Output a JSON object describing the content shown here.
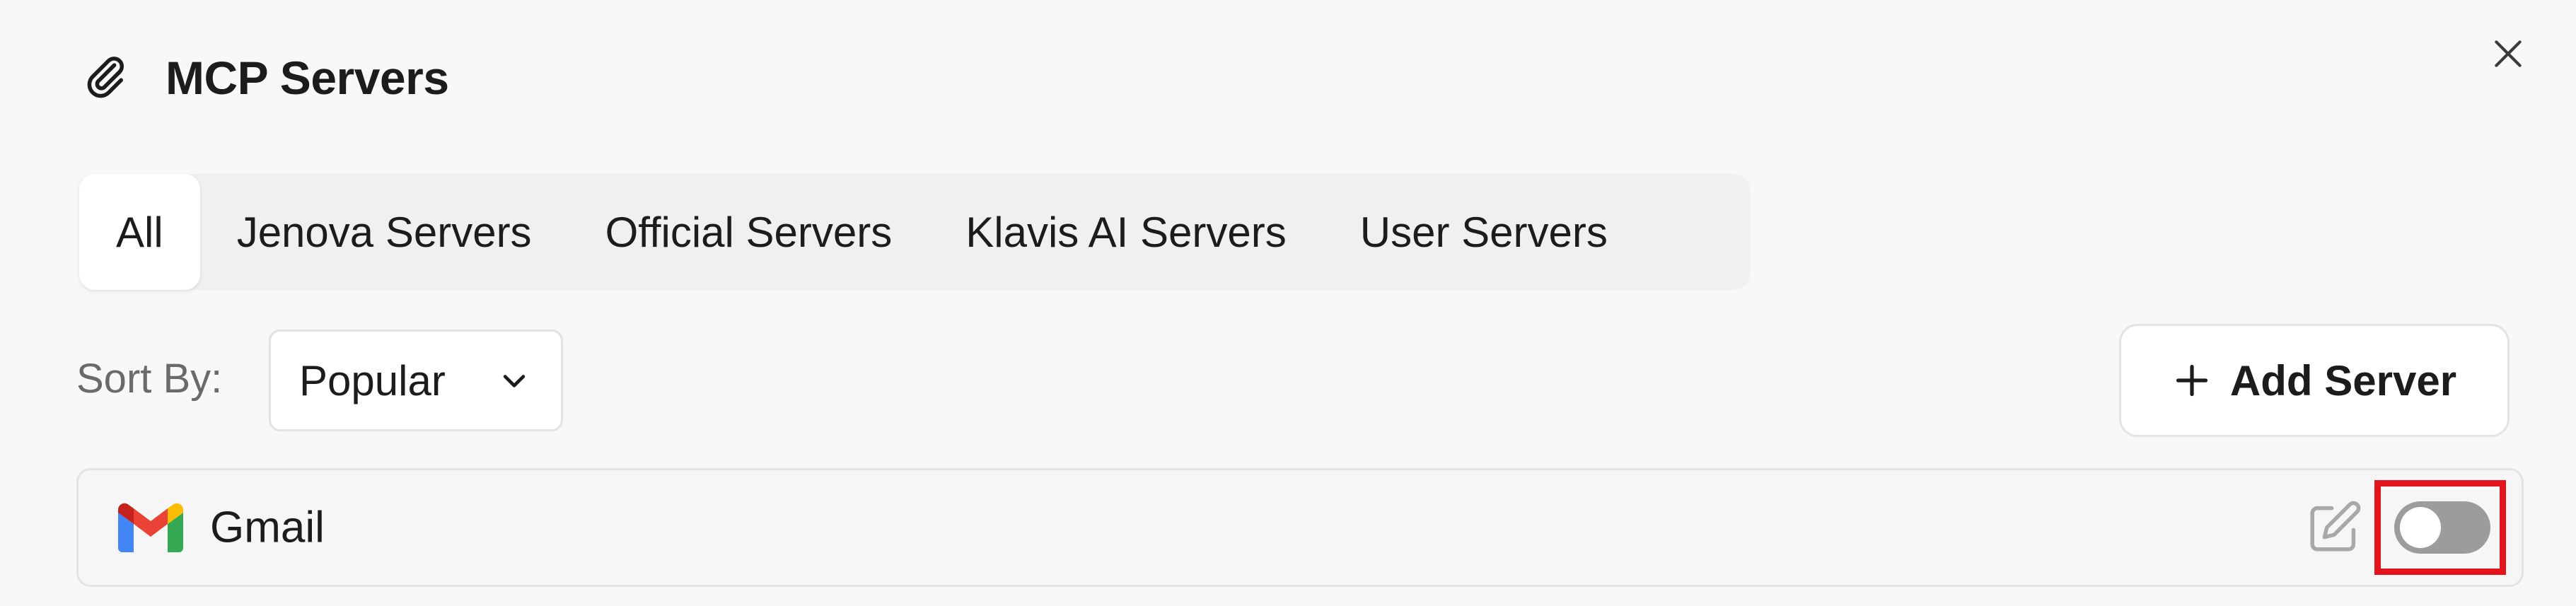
{
  "dialog": {
    "title": "MCP Servers",
    "title_icon": "paperclip-icon",
    "close_icon": "close-icon"
  },
  "tabs": [
    {
      "label": "All",
      "active": true
    },
    {
      "label": "Jenova Servers",
      "active": false
    },
    {
      "label": "Official Servers",
      "active": false
    },
    {
      "label": "Klavis AI Servers",
      "active": false
    },
    {
      "label": "User Servers",
      "active": false
    }
  ],
  "sort": {
    "label": "Sort By:",
    "selected": "Popular",
    "icon": "chevron-down-icon"
  },
  "add_server": {
    "label": "Add Server",
    "icon": "plus-icon"
  },
  "servers": [
    {
      "name": "Gmail",
      "icon": "gmail-icon",
      "edit_icon": "edit-icon",
      "enabled": false
    }
  ],
  "colors": {
    "background": "#f8f8f8",
    "tab_bar": "#f0f0f0",
    "toggle_off": "#9c9c9c",
    "highlight": "#e4141c",
    "gmail_red": "#ea4335",
    "gmail_blue": "#4285f4",
    "gmail_green": "#34a853",
    "gmail_yellow": "#fbbc04",
    "gmail_darkred": "#c5221f"
  }
}
